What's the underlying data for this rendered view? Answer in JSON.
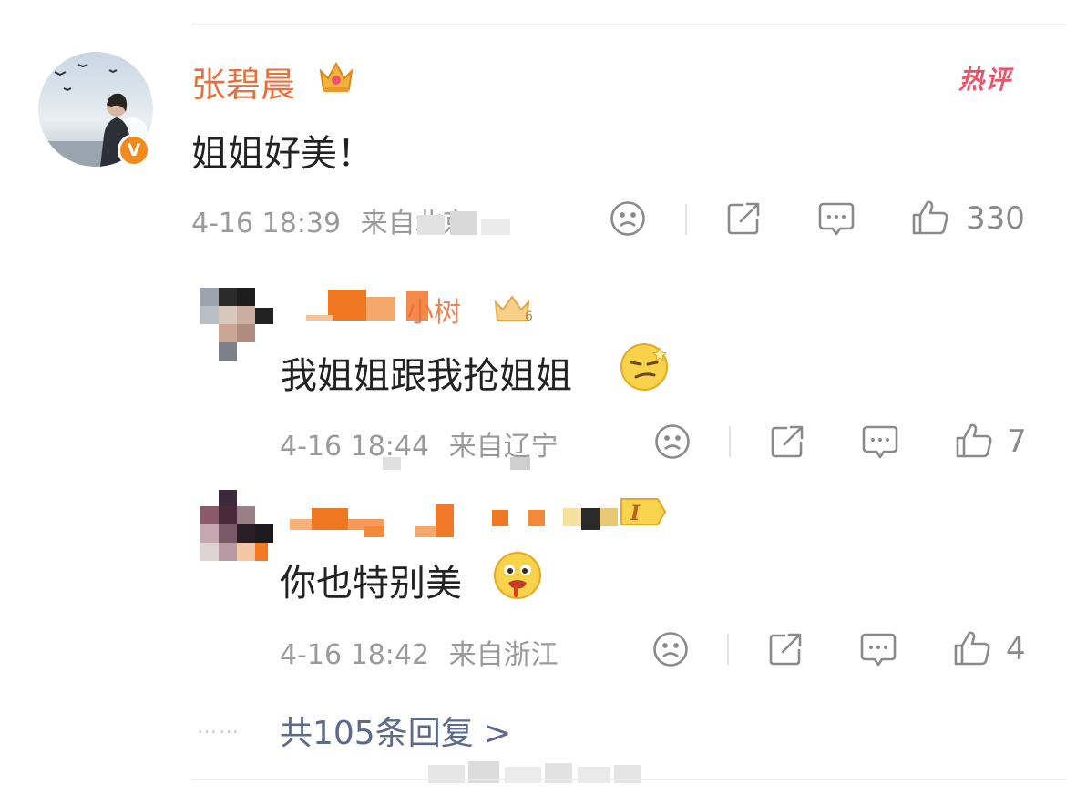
{
  "main_comment": {
    "author": "张碧晨",
    "badge": "热评",
    "text": "姐姐好美！",
    "time": "4-16 18:39",
    "location": "来自北京",
    "like_count": "330"
  },
  "replies": [
    {
      "author": "小树",
      "text": "我姐姐跟我抢姐姐",
      "time": "4-16 18:44",
      "location": "来自辽宁",
      "like_count": "7"
    },
    {
      "author": "",
      "level_badge": "I",
      "text": "你也特别美",
      "time": "4-16 18:42",
      "location": "来自浙江",
      "like_count": "4"
    }
  ],
  "more": {
    "dots": "……",
    "label": "共105条回复 >"
  },
  "colors": {
    "name": "#e8703a",
    "hot": "#e8546a",
    "meta": "#9a9a9a",
    "link": "#5b6a8a",
    "icon": "#8a8a8a"
  }
}
